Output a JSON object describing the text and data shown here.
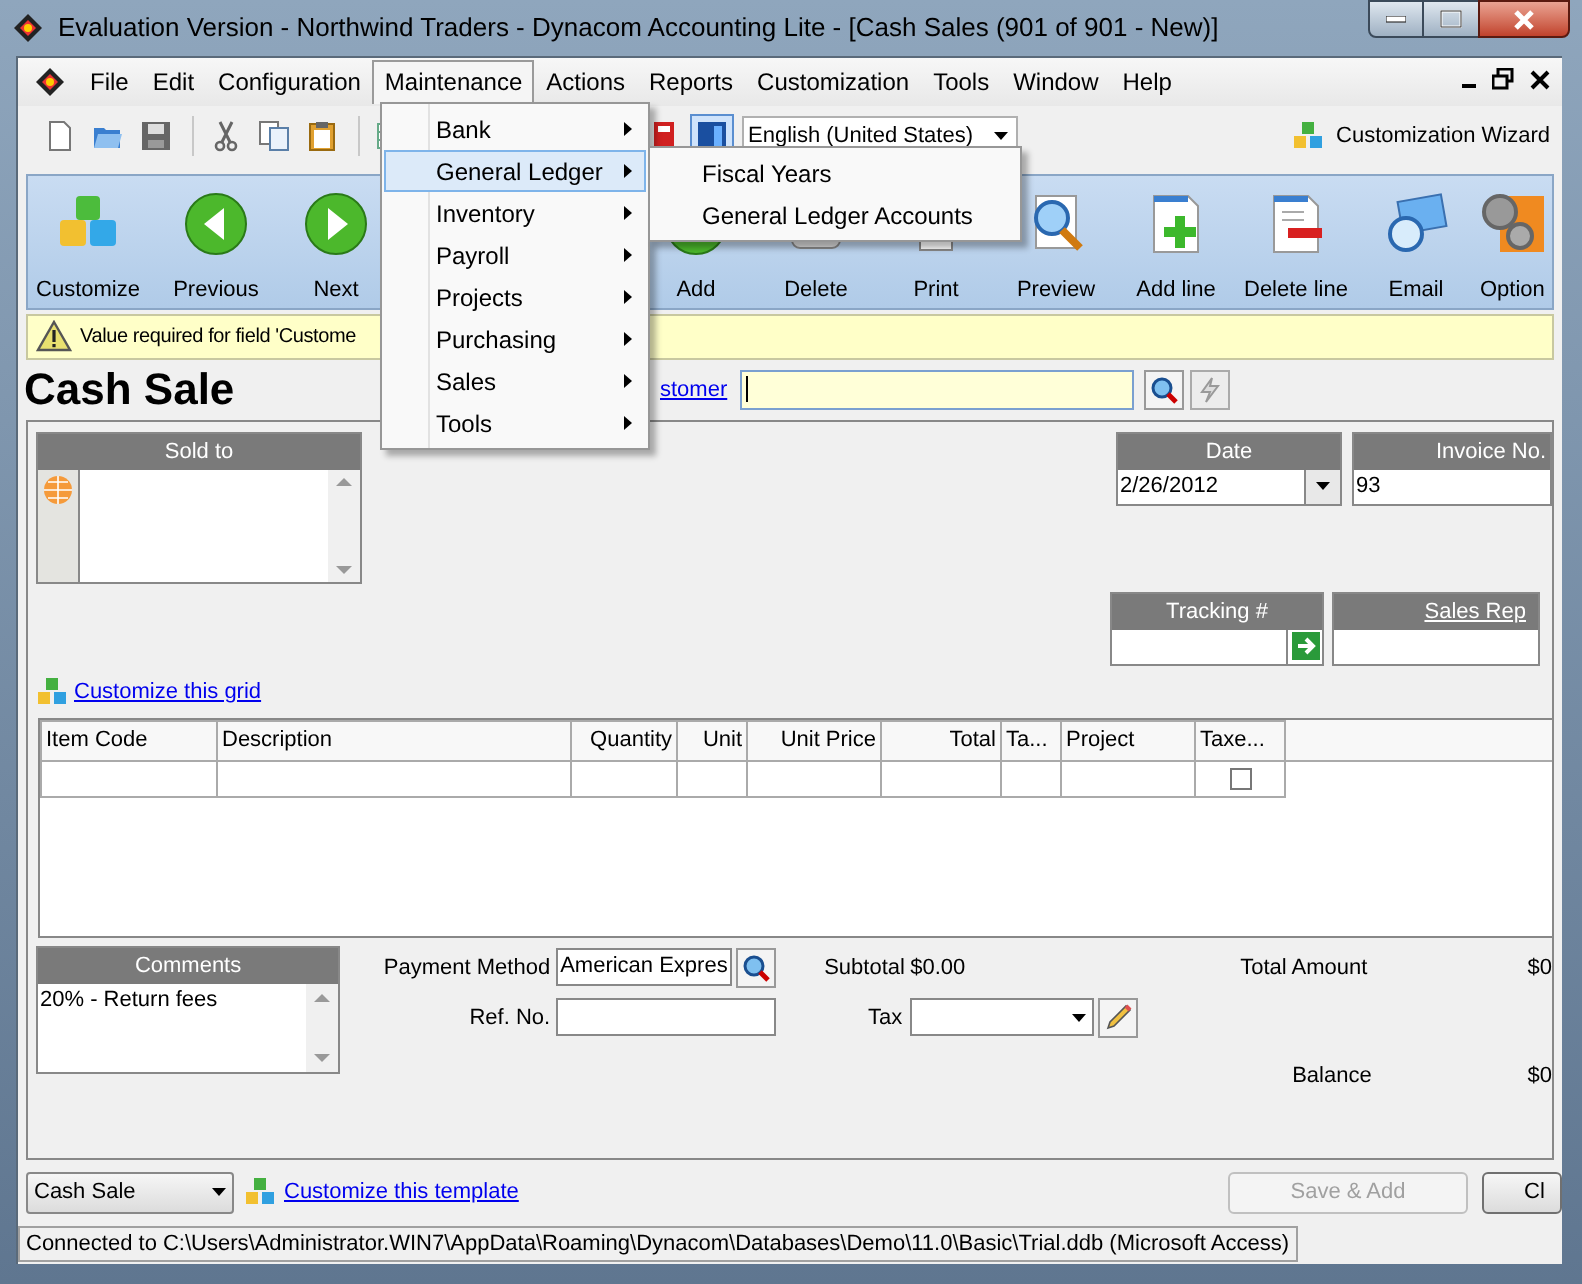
{
  "window": {
    "title": "Evaluation Version - Northwind Traders - Dynacom Accounting Lite - [Cash Sales (901 of 901 - New)]"
  },
  "menu_bar": [
    {
      "label": "File",
      "selected": false
    },
    {
      "label": "Edit",
      "selected": false
    },
    {
      "label": "Configuration",
      "selected": false
    },
    {
      "label": "Maintenance",
      "selected": true
    },
    {
      "label": "Actions",
      "selected": false
    },
    {
      "label": "Reports",
      "selected": false
    },
    {
      "label": "Customization",
      "selected": false
    },
    {
      "label": "Tools",
      "selected": false
    },
    {
      "label": "Window",
      "selected": false
    },
    {
      "label": "Help",
      "selected": false
    }
  ],
  "toolbar": {
    "language": "English (United States)",
    "wizard": "Customization Wizard"
  },
  "ribbon": [
    {
      "label": "Customize",
      "kind": "cubes"
    },
    {
      "label": "Previous",
      "kind": "back"
    },
    {
      "label": "Next",
      "kind": "forward"
    },
    {
      "label": "Add",
      "kind": "add"
    },
    {
      "label": "Delete",
      "kind": "delete"
    },
    {
      "label": "Print",
      "kind": "print"
    },
    {
      "label": "Preview",
      "kind": "preview"
    },
    {
      "label": "Add line",
      "kind": "addline"
    },
    {
      "label": "Delete line",
      "kind": "deleteline"
    },
    {
      "label": "Email",
      "kind": "email"
    },
    {
      "label": "Option",
      "kind": "options"
    }
  ],
  "warning": "Value required for field 'Custome",
  "form": {
    "title": "Cash Sale",
    "customer_link": "stomer",
    "sold_to": {
      "label": "Sold to"
    },
    "date": {
      "label": "Date",
      "value": "2/26/2012"
    },
    "invoice": {
      "label": "Invoice No.",
      "value": "93"
    },
    "tracking": {
      "label": "Tracking #"
    },
    "sales_rep": {
      "label": "Sales Rep"
    },
    "grid_link": "Customize this grid",
    "table": {
      "columns": [
        "Item Code",
        "Description",
        "Quantity",
        "Unit",
        "Unit Price",
        "Total",
        "Ta...",
        "Project",
        "Taxe..."
      ],
      "rows": [
        {
          "taxable": false
        }
      ]
    },
    "comments": {
      "label": "Comments",
      "value": "20% - Return fees"
    },
    "payment_method": {
      "label": "Payment Method",
      "value": "American Expres"
    },
    "ref_no": {
      "label": "Ref. No."
    },
    "subtotal": {
      "label": "Subtotal",
      "value": "$0.00"
    },
    "tax": {
      "label": "Tax"
    },
    "total_amount": {
      "label": "Total Amount",
      "value": "$0"
    },
    "balance": {
      "label": "Balance",
      "value": "$0"
    }
  },
  "footer": {
    "template": "Cash Sale",
    "link": "Customize this template",
    "buttons": [
      {
        "label": "Save & Add",
        "disabled": true
      },
      {
        "label": "Cl",
        "disabled": false
      }
    ]
  },
  "status_bar": "Connected to C:\\Users\\Administrator.WIN7\\AppData\\Roaming\\Dynacom\\Databases\\Demo\\11.0\\Basic\\Trial.ddb (Microsoft Access)",
  "maintenance_menu": [
    {
      "label": "Bank",
      "selected": false
    },
    {
      "label": "General Ledger",
      "selected": true
    },
    {
      "label": "Inventory",
      "selected": false
    },
    {
      "label": "Payroll",
      "selected": false
    },
    {
      "label": "Projects",
      "selected": false
    },
    {
      "label": "Purchasing",
      "selected": false
    },
    {
      "label": "Sales",
      "selected": false
    },
    {
      "label": "Tools",
      "selected": false
    }
  ],
  "submenu": [
    {
      "label": "Fiscal Years"
    },
    {
      "label": "General Ledger Accounts"
    }
  ]
}
